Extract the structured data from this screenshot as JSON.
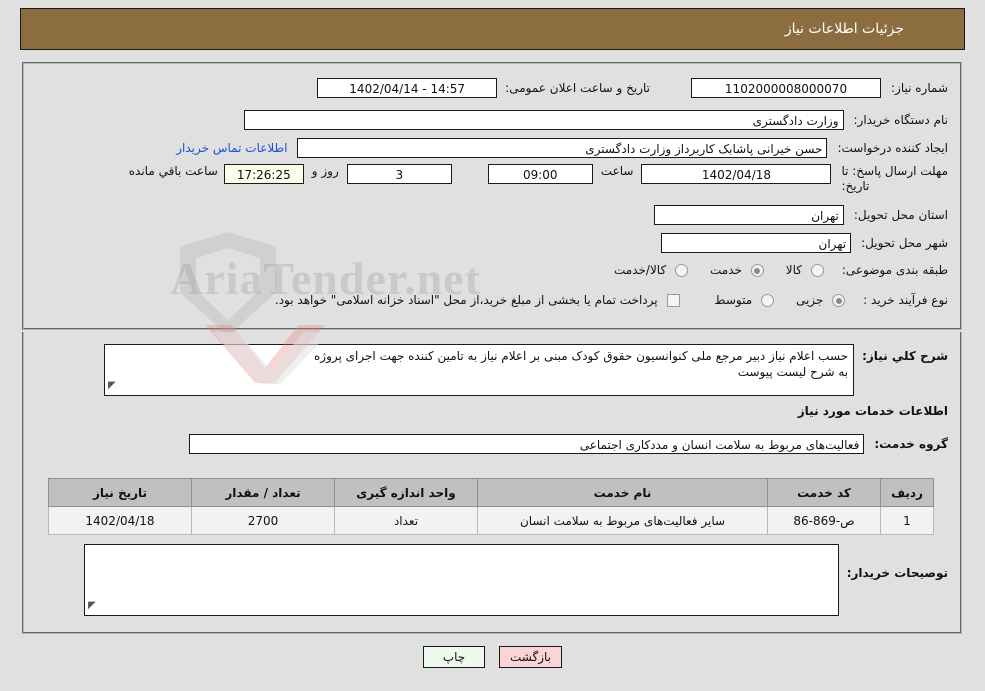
{
  "header": {
    "title": "جزئیات اطلاعات نیاز"
  },
  "form": {
    "need_number_label": "شماره نیاز:",
    "need_number_value": "1102000008000070",
    "announce_datetime_label": "تاریخ و ساعت اعلان عمومی:",
    "announce_datetime_value": "14:57 - 1402/04/14",
    "buyer_org_label": "نام دستگاه خریدار:",
    "buyer_org_value": "وزارت دادگستری",
    "creator_label": "ایجاد کننده درخواست:",
    "creator_value": "حسن خیرانی پاشابک کاربرداز وزارت دادگستری",
    "contact_link": "اطلاعات تماس خریدار",
    "deadline_label_line1": "مهلت ارسال پاسخ: تا",
    "deadline_label_line2": "تاریخ:",
    "deadline_date": "1402/04/18",
    "hour_label": "ساعت",
    "hour_value": "09:00",
    "days_value": "3",
    "days_unit": "روز و",
    "remaining_time": "17:26:25",
    "remaining_suffix": "ساعت باقي مانده",
    "province_label": "استان محل تحویل:",
    "province_value": "تهران",
    "city_label": "شهر محل تحویل:",
    "city_value": "تهران",
    "category_label": "طبقه بندی موضوعی:",
    "category_options": [
      {
        "label": "کالا",
        "selected": false
      },
      {
        "label": "خدمت",
        "selected": true
      },
      {
        "label": "کالا/خدمت",
        "selected": false
      }
    ],
    "process_type_label": "نوع فرآیند خرید :",
    "process_type_options": [
      {
        "label": "جزیی",
        "selected": true
      },
      {
        "label": "متوسط",
        "selected": false
      }
    ],
    "treasury_checkbox_label": "پرداخت تمام یا بخشی از مبلغ خرید،از محل \"اسناد خزانه اسلامی\" خواهد بود.",
    "treasury_checkbox_checked": false
  },
  "description": {
    "label": "شرح کلي نیاز:",
    "line1": "حسب اعلام نیاز دبیر مرجع ملی کنوانسیون حقوق کودک مبنی بر اعلام نیاز به تامین کننده جهت اجرای پروژه",
    "line2": "به شرح لیست پیوست"
  },
  "services": {
    "section_title": "اطلاعات خدمات مورد نیاز",
    "group_label": "گروه خدمت:",
    "group_value": "فعالیت‌های مربوط به سلامت انسان و مددکاری اجتماعی",
    "columns": [
      "ردیف",
      "کد خدمت",
      "نام خدمت",
      "واحد اندازه گیری",
      "تعداد / مقدار",
      "تاریخ نیاز"
    ],
    "rows": [
      {
        "index": "1",
        "code": "ص-869-86",
        "name": "سایر فعالیت‌های مربوط به سلامت انسان",
        "unit": "تعداد",
        "quantity": "2700",
        "date": "1402/04/18"
      }
    ]
  },
  "buyer_notes": {
    "label": "توصیحات خریدار:",
    "value": ""
  },
  "footer": {
    "print_label": "چاپ",
    "back_label": "بازگشت"
  },
  "watermark": {
    "text": "AriaTender.net"
  },
  "colors": {
    "header_bg": "#8c6d3f",
    "page_bg": "#e0e0e0",
    "link": "#1f4fd8",
    "table_header_bg": "#c0c0c0",
    "print_btn_bg": "#ecf9ec",
    "back_btn_bg": "#fbd5d5",
    "highlight_field_bg": "#fdfce8"
  }
}
